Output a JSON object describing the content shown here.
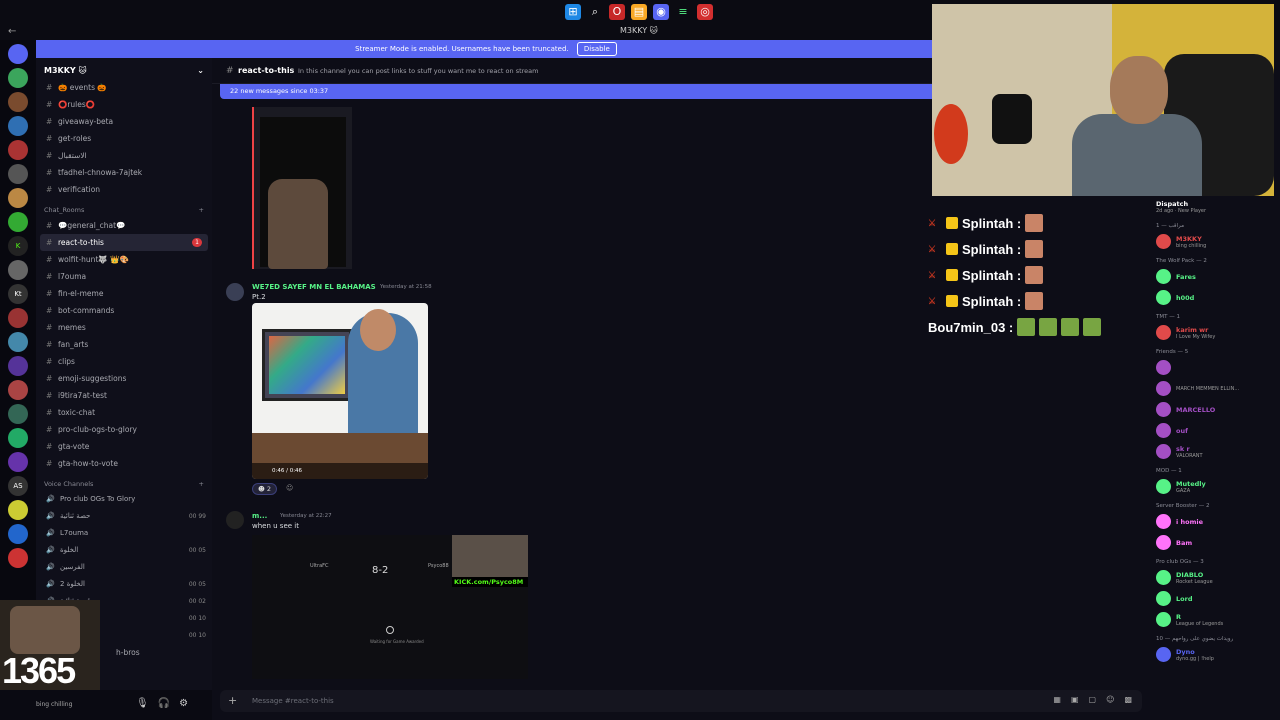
{
  "window": {
    "title": "M3KKY 🐱"
  },
  "banner": {
    "text": "Streamer Mode is enabled. Usernames have been truncated.",
    "disable_label": "Disable"
  },
  "server": {
    "name": "M3KKY 🐱",
    "channels_top": [
      {
        "label": "🎃 events 🎃"
      },
      {
        "label": "⭕rules⭕"
      },
      {
        "label": "giveaway-beta"
      },
      {
        "label": "get-roles"
      },
      {
        "label": "الاستقبال"
      },
      {
        "label": "tfadhel-chnowa-7ajtek"
      },
      {
        "label": "verification"
      }
    ],
    "category_chat": "Chat_Rooms",
    "channels_chat": [
      {
        "label": "💬general_chat💬",
        "active": false
      },
      {
        "label": "react-to-this",
        "active": true,
        "badge": "1"
      },
      {
        "label": "wolfit-hunt🐺 👑🎨",
        "active": false
      },
      {
        "label": "l7ouma",
        "active": false
      },
      {
        "label": "fin-el-meme",
        "active": false
      },
      {
        "label": "bot-commands",
        "active": false
      },
      {
        "label": "memes",
        "active": false
      },
      {
        "label": "fan_arts",
        "active": false
      },
      {
        "label": "clips",
        "active": false
      },
      {
        "label": "emoji-suggestions",
        "active": false
      },
      {
        "label": "i9tira7at-test",
        "active": false
      },
      {
        "label": "toxic-chat",
        "active": false
      },
      {
        "label": "pro-club-ogs-to-glory",
        "active": false
      },
      {
        "label": "gta-vote",
        "active": false
      },
      {
        "label": "gta-how-to-vote",
        "active": false
      }
    ],
    "category_voice": "Voice Channels",
    "voice_channels": [
      {
        "label": "Pro club OGs To Glory",
        "count": ""
      },
      {
        "label": "حصة ثنائية",
        "count": "00 99"
      },
      {
        "label": "L7ouma",
        "count": ""
      },
      {
        "label": "الخلوة",
        "count": "00 05"
      },
      {
        "label": "الفرسين",
        "count": ""
      },
      {
        "label": "الخلوة 2",
        "count": "00 05"
      },
      {
        "label": "قعدة ثنائية",
        "count": "00 02"
      },
      {
        "label": "الخلوة",
        "count": "00 10"
      },
      {
        "label": "الخلوة",
        "count": "00 10"
      }
    ],
    "partial_channel": "h-bros"
  },
  "user_panel": {
    "status": "bing chilling",
    "webcam_number": "1365"
  },
  "channel": {
    "name": "react-to-this",
    "topic": "In this channel you can post links to stuff you want me to react on stream",
    "new_messages": "22 new messages since 03:37",
    "composer_placeholder": "Message #react-to-this"
  },
  "messages": [
    {
      "author": "WE7ED SAYEF MN EL BAHAMAS",
      "time": "Yesterday at 21:58",
      "text": "Pt.2",
      "video_time": "0:46 / 0:46",
      "reaction_count": "2"
    },
    {
      "author": "m...",
      "time": "Yesterday at 22:27",
      "text": "when u see it",
      "score": "8-2",
      "team_left": "UltraFC",
      "team_right": "Psyco88",
      "kick_text": "KICK.com/Psyco8M",
      "wait_text": "Waiting for Game Awarded"
    }
  ],
  "stream_chat": [
    {
      "user": "Splintah :"
    },
    {
      "user": "Splintah :"
    },
    {
      "user": "Splintah :"
    },
    {
      "user": "Splintah :"
    },
    {
      "user": "Bou7min_03 :"
    }
  ],
  "members": {
    "top_name": "Dispatch",
    "top_sub": "2d ago · New Player",
    "sections": [
      {
        "title": "مراقب — 1",
        "items": [
          {
            "name": "M3KKY",
            "sub": "bing chilling",
            "color": "#e04a4a"
          }
        ]
      },
      {
        "title": "The Wolf Pack — 2",
        "items": [
          {
            "name": "Fares",
            "sub": "",
            "color": "#57f287"
          },
          {
            "name": "h00d",
            "sub": "",
            "color": "#57f287"
          }
        ]
      },
      {
        "title": "TMT — 1",
        "items": [
          {
            "name": "karim wr",
            "sub": "I Love My Wifey",
            "color": "#e04a4a"
          }
        ]
      },
      {
        "title": "Friends — 5",
        "items": [
          {
            "name": "",
            "sub": "",
            "color": "#a34fc4"
          },
          {
            "name": "",
            "sub": "MARCH MEMMEN ELLIN...",
            "color": "#a34fc4"
          },
          {
            "name": "MARCELLO",
            "sub": "",
            "color": "#a34fc4"
          },
          {
            "name": "ouf",
            "sub": "",
            "color": "#a34fc4"
          },
          {
            "name": "sk r",
            "sub": "VALORANT",
            "color": "#a34fc4"
          }
        ]
      },
      {
        "title": "MOD — 1",
        "items": [
          {
            "name": "Mutedly",
            "sub": "GAZA",
            "color": "#57f287"
          }
        ]
      },
      {
        "title": "Server Booster — 2",
        "items": [
          {
            "name": "i homie",
            "sub": "",
            "color": "#ff73fa"
          },
          {
            "name": "Bam",
            "sub": "",
            "color": "#ff73fa"
          }
        ]
      },
      {
        "title": "Pro club OGs — 3",
        "items": [
          {
            "name": "DIABLO",
            "sub": "Rocket League",
            "color": "#57f287"
          },
          {
            "name": "Lord",
            "sub": "",
            "color": "#57f287"
          },
          {
            "name": "R",
            "sub": "League of Legends",
            "color": "#57f287"
          }
        ]
      },
      {
        "title": "رويدات يضوي على رواحهم — 10",
        "items": [
          {
            "name": "Dyno",
            "sub": "dyno.gg | !help",
            "color": "#5865f2"
          }
        ]
      }
    ]
  }
}
